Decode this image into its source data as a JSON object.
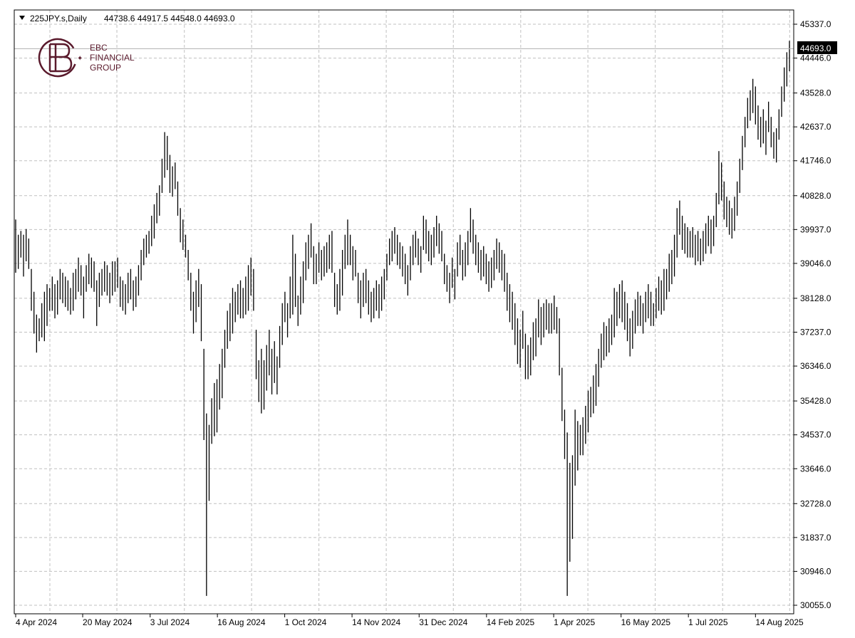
{
  "header": {
    "symbol": "225JPY.s,Daily",
    "ohlc": "44738.6 44917.5 44548.0 44693.0"
  },
  "logo": {
    "line1": "EBC",
    "line2": "FINANCIAL",
    "line3": "GROUP",
    "color": "#5a1a2c"
  },
  "colors": {
    "bars": "#000000",
    "grid": "#c0c0c0",
    "last_price_bg": "#000000"
  },
  "chart_data": {
    "type": "ohlc",
    "title": "",
    "xlabel": "",
    "ylabel": "",
    "ylim": [
      30055.0,
      45337.0
    ],
    "grid": true,
    "y_ticks": [
      "45337.0",
      "44446.0",
      "43528.0",
      "42637.0",
      "41746.0",
      "40828.0",
      "39937.0",
      "39046.0",
      "38128.0",
      "37237.0",
      "36346.0",
      "35428.0",
      "34537.0",
      "33646.0",
      "32728.0",
      "31837.0",
      "30946.0",
      "30055.0"
    ],
    "x_ticks": [
      "4 Apr 2024",
      "20 May 2024",
      "3 Jul 2024",
      "16 Aug 2024",
      "1 Oct 2024",
      "14 Nov 2024",
      "31 Dec 2024",
      "14 Feb 2025",
      "1 Apr 2025",
      "16 May 2025",
      "1 Jul 2025",
      "14 Aug 2025"
    ],
    "last_price": "44693.0",
    "series": [
      {
        "values_hl": [
          [
            40200,
            38800
          ],
          [
            39800,
            38900
          ],
          [
            39900,
            39200
          ],
          [
            39800,
            38700
          ],
          [
            39950,
            39100
          ],
          [
            39700,
            38900
          ],
          [
            38900,
            37800
          ],
          [
            38300,
            37200
          ],
          [
            37700,
            36700
          ],
          [
            37600,
            37000
          ],
          [
            38000,
            37100
          ],
          [
            38300,
            37000
          ],
          [
            38500,
            37400
          ],
          [
            38400,
            37800
          ],
          [
            38700,
            37800
          ],
          [
            38500,
            37600
          ],
          [
            38600,
            37700
          ],
          [
            38900,
            38100
          ],
          [
            38800,
            38000
          ],
          [
            38700,
            37900
          ],
          [
            38600,
            37800
          ],
          [
            38400,
            37700
          ],
          [
            38800,
            37800
          ],
          [
            38900,
            38100
          ],
          [
            39200,
            38300
          ],
          [
            39000,
            38200
          ],
          [
            38700,
            37600
          ],
          [
            39000,
            38300
          ],
          [
            39300,
            38500
          ],
          [
            39200,
            38400
          ],
          [
            39100,
            38300
          ],
          [
            38600,
            37400
          ],
          [
            38800,
            37900
          ],
          [
            38900,
            38200
          ],
          [
            39100,
            38300
          ],
          [
            39000,
            38200
          ],
          [
            38800,
            38000
          ],
          [
            39100,
            38200
          ],
          [
            39100,
            38300
          ],
          [
            39200,
            38400
          ],
          [
            38700,
            37900
          ],
          [
            38600,
            37800
          ],
          [
            38500,
            37700
          ],
          [
            38800,
            38000
          ],
          [
            38900,
            38100
          ],
          [
            38600,
            37800
          ],
          [
            38700,
            37900
          ],
          [
            39000,
            38200
          ],
          [
            39400,
            38600
          ],
          [
            39700,
            39000
          ],
          [
            39800,
            39200
          ],
          [
            39900,
            39300
          ],
          [
            40300,
            39500
          ],
          [
            40600,
            39700
          ],
          [
            40900,
            40100
          ],
          [
            41100,
            40300
          ],
          [
            41800,
            40900
          ],
          [
            42500,
            41300
          ],
          [
            42400,
            41500
          ],
          [
            41900,
            40900
          ],
          [
            41600,
            40800
          ],
          [
            41700,
            41000
          ],
          [
            41200,
            40300
          ],
          [
            40500,
            39600
          ],
          [
            40200,
            39400
          ],
          [
            39800,
            39200
          ],
          [
            39400,
            38600
          ],
          [
            38800,
            37800
          ],
          [
            38300,
            37200
          ],
          [
            38600,
            37500
          ],
          [
            38900,
            37900
          ],
          [
            38500,
            37000
          ],
          [
            36800,
            34400
          ],
          [
            35100,
            30300
          ],
          [
            34800,
            32800
          ],
          [
            35500,
            34300
          ],
          [
            35900,
            34500
          ],
          [
            36000,
            34600
          ],
          [
            36400,
            35200
          ],
          [
            36800,
            35500
          ],
          [
            37300,
            36300
          ],
          [
            37800,
            36800
          ],
          [
            38000,
            37000
          ],
          [
            38400,
            37200
          ],
          [
            38300,
            37500
          ],
          [
            38500,
            37700
          ],
          [
            38600,
            37600
          ],
          [
            38400,
            37600
          ],
          [
            38700,
            37700
          ],
          [
            39000,
            37800
          ],
          [
            39200,
            38200
          ],
          [
            38900,
            37800
          ],
          [
            37300,
            36000
          ],
          [
            36500,
            35400
          ],
          [
            36800,
            35100
          ],
          [
            36500,
            35200
          ],
          [
            36900,
            35700
          ],
          [
            37300,
            36100
          ],
          [
            36800,
            35600
          ],
          [
            37000,
            35900
          ],
          [
            36600,
            35600
          ],
          [
            37400,
            36300
          ],
          [
            38000,
            36900
          ],
          [
            38300,
            37500
          ],
          [
            38000,
            37100
          ],
          [
            38700,
            37600
          ],
          [
            39800,
            37700
          ],
          [
            39300,
            37900
          ],
          [
            38200,
            37400
          ],
          [
            38700,
            37700
          ],
          [
            39100,
            38000
          ],
          [
            39600,
            38600
          ],
          [
            39800,
            38900
          ],
          [
            40100,
            39200
          ],
          [
            39500,
            38500
          ],
          [
            39300,
            38500
          ],
          [
            39600,
            38800
          ],
          [
            39400,
            38600
          ],
          [
            39500,
            38700
          ],
          [
            39600,
            38800
          ],
          [
            39800,
            38900
          ],
          [
            39900,
            38800
          ],
          [
            38800,
            37900
          ],
          [
            38500,
            37700
          ],
          [
            38900,
            37800
          ],
          [
            39400,
            38200
          ],
          [
            39800,
            38900
          ],
          [
            40200,
            39000
          ],
          [
            39800,
            39000
          ],
          [
            39500,
            38600
          ],
          [
            39400,
            38700
          ],
          [
            38800,
            38000
          ],
          [
            38600,
            37600
          ],
          [
            38800,
            37900
          ],
          [
            38900,
            38000
          ],
          [
            38600,
            37700
          ],
          [
            38300,
            37500
          ],
          [
            38400,
            37600
          ],
          [
            38600,
            37800
          ],
          [
            38500,
            37600
          ],
          [
            38700,
            37800
          ],
          [
            38900,
            38100
          ],
          [
            39300,
            38600
          ],
          [
            39700,
            39000
          ],
          [
            39900,
            39100
          ],
          [
            40000,
            39300
          ],
          [
            39800,
            39000
          ],
          [
            39600,
            38900
          ],
          [
            39500,
            38700
          ],
          [
            39300,
            38500
          ],
          [
            39000,
            38200
          ],
          [
            39500,
            38600
          ],
          [
            39800,
            39000
          ],
          [
            39900,
            39200
          ],
          [
            39700,
            39000
          ],
          [
            39500,
            38800
          ],
          [
            40300,
            39400
          ],
          [
            40200,
            39300
          ],
          [
            39900,
            39100
          ],
          [
            39800,
            39000
          ],
          [
            40000,
            39200
          ],
          [
            40300,
            39500
          ],
          [
            40100,
            39300
          ],
          [
            39900,
            39100
          ],
          [
            39300,
            38500
          ],
          [
            39000,
            38300
          ],
          [
            38800,
            38000
          ],
          [
            39200,
            38400
          ],
          [
            38900,
            38100
          ],
          [
            39600,
            38700
          ],
          [
            39800,
            39000
          ],
          [
            39400,
            38600
          ],
          [
            39600,
            38700
          ],
          [
            39900,
            39000
          ],
          [
            40500,
            39600
          ],
          [
            40200,
            39300
          ],
          [
            39800,
            39000
          ],
          [
            39600,
            38800
          ],
          [
            39400,
            38600
          ],
          [
            39500,
            38700
          ],
          [
            39300,
            38500
          ],
          [
            39100,
            38300
          ],
          [
            39200,
            38400
          ],
          [
            39400,
            38600
          ],
          [
            39700,
            38900
          ],
          [
            39600,
            38800
          ],
          [
            39400,
            38600
          ],
          [
            39300,
            38300
          ],
          [
            38800,
            37800
          ],
          [
            38500,
            37500
          ],
          [
            38300,
            37300
          ],
          [
            38000,
            36900
          ],
          [
            37600,
            36400
          ],
          [
            37300,
            36300
          ],
          [
            37800,
            36800
          ],
          [
            37200,
            36000
          ],
          [
            36900,
            36000
          ],
          [
            37100,
            36100
          ],
          [
            37500,
            36500
          ],
          [
            37600,
            36600
          ],
          [
            38100,
            37100
          ],
          [
            37900,
            36900
          ],
          [
            38000,
            37100
          ],
          [
            38100,
            37300
          ],
          [
            38000,
            37200
          ],
          [
            38000,
            37200
          ],
          [
            38200,
            37300
          ],
          [
            37900,
            37200
          ],
          [
            37600,
            36100
          ],
          [
            36300,
            34900
          ],
          [
            35200,
            33900
          ],
          [
            34600,
            30300
          ],
          [
            33800,
            31200
          ],
          [
            34000,
            31800
          ],
          [
            35200,
            33200
          ],
          [
            34900,
            33600
          ],
          [
            34800,
            34000
          ],
          [
            35000,
            34000
          ],
          [
            35300,
            34300
          ],
          [
            35700,
            34600
          ],
          [
            35800,
            35000
          ],
          [
            36100,
            35100
          ],
          [
            36400,
            35300
          ],
          [
            36800,
            35800
          ],
          [
            37200,
            36300
          ],
          [
            37500,
            36500
          ],
          [
            37400,
            36600
          ],
          [
            37600,
            36700
          ],
          [
            37700,
            36900
          ],
          [
            38400,
            37100
          ],
          [
            38300,
            37400
          ],
          [
            38500,
            37600
          ],
          [
            38600,
            37500
          ],
          [
            38300,
            37300
          ],
          [
            38000,
            37000
          ],
          [
            37600,
            36600
          ],
          [
            37800,
            36800
          ],
          [
            38100,
            37200
          ],
          [
            38300,
            37400
          ],
          [
            38200,
            37400
          ],
          [
            38000,
            37200
          ],
          [
            38300,
            37500
          ],
          [
            38500,
            37600
          ],
          [
            38300,
            37400
          ],
          [
            38000,
            37400
          ],
          [
            38400,
            37600
          ],
          [
            38700,
            37800
          ],
          [
            38600,
            37700
          ],
          [
            38900,
            37800
          ],
          [
            38900,
            38100
          ],
          [
            39300,
            38300
          ],
          [
            39400,
            38500
          ],
          [
            39800,
            38700
          ],
          [
            40500,
            39200
          ],
          [
            40700,
            39800
          ],
          [
            40300,
            39400
          ],
          [
            40100,
            39300
          ],
          [
            40000,
            39200
          ],
          [
            39900,
            39200
          ],
          [
            40000,
            39200
          ],
          [
            39800,
            39000
          ],
          [
            39900,
            39100
          ],
          [
            39700,
            39000
          ],
          [
            39900,
            39100
          ],
          [
            40100,
            39300
          ],
          [
            40300,
            39500
          ],
          [
            40200,
            39300
          ],
          [
            40300,
            39500
          ],
          [
            40900,
            40000
          ],
          [
            42000,
            40600
          ],
          [
            41700,
            40700
          ],
          [
            41200,
            40200
          ],
          [
            40800,
            40000
          ],
          [
            40700,
            39800
          ],
          [
            40500,
            39700
          ],
          [
            40800,
            39900
          ],
          [
            41200,
            40300
          ],
          [
            41800,
            40900
          ],
          [
            42400,
            41500
          ],
          [
            42900,
            42100
          ],
          [
            43400,
            42600
          ],
          [
            43600,
            42800
          ],
          [
            43900,
            43000
          ],
          [
            43700,
            42700
          ],
          [
            43200,
            42300
          ],
          [
            42900,
            42100
          ],
          [
            43100,
            42200
          ],
          [
            42800,
            41900
          ],
          [
            43300,
            42500
          ],
          [
            42900,
            42100
          ],
          [
            42500,
            41800
          ],
          [
            42600,
            41700
          ],
          [
            43100,
            42300
          ],
          [
            43700,
            42900
          ],
          [
            44200,
            43300
          ],
          [
            44600,
            43700
          ],
          [
            44900,
            44100
          ]
        ]
      }
    ]
  }
}
